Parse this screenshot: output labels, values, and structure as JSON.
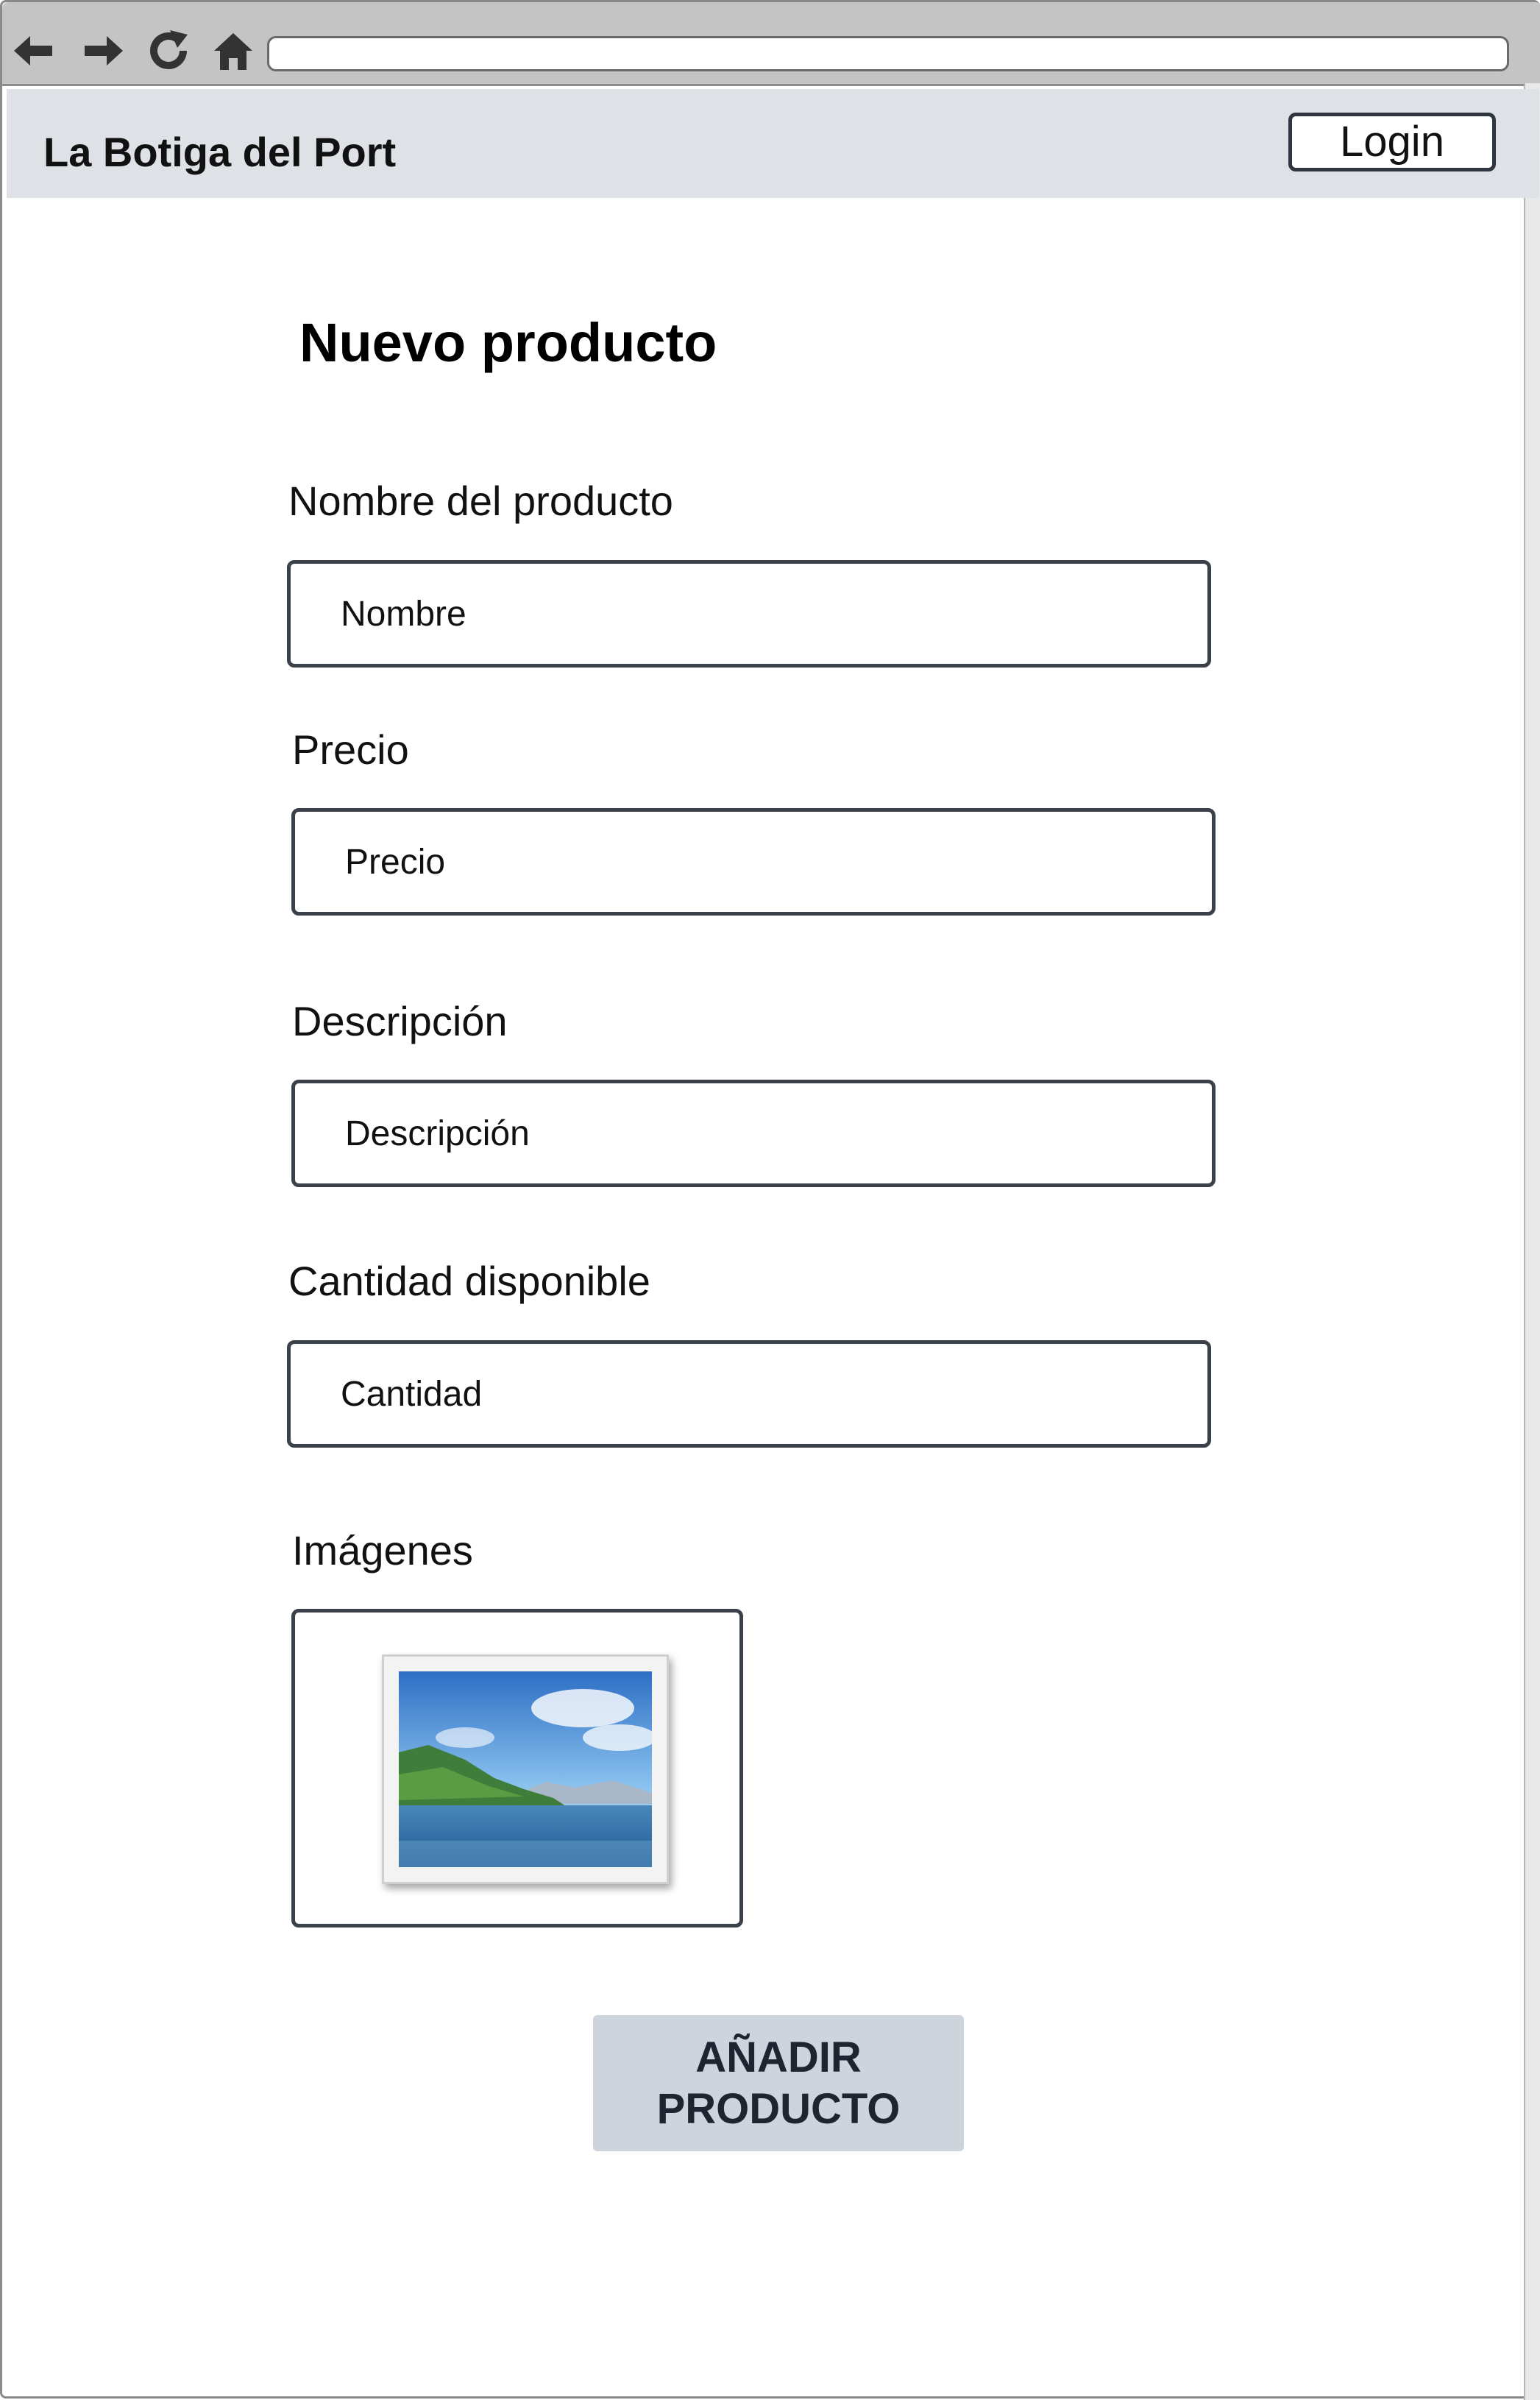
{
  "site": {
    "brand": "La Botiga del Port",
    "login_label": "Login"
  },
  "form": {
    "title": "Nuevo producto",
    "fields": [
      {
        "label": "Nombre del producto",
        "placeholder": "Nombre"
      },
      {
        "label": "Precio",
        "placeholder": "Precio"
      },
      {
        "label": "Descripción",
        "placeholder": "Descripción"
      },
      {
        "label": "Cantidad disponible",
        "placeholder": "Cantidad"
      }
    ],
    "images_label": "Imágenes",
    "image_icon": "landscape-image-placeholder-icon",
    "submit_label": "AÑADIR PRODUCTO"
  },
  "browser": {
    "icons": [
      "back-arrow-icon",
      "forward-arrow-icon",
      "reload-icon",
      "home-icon"
    ]
  }
}
